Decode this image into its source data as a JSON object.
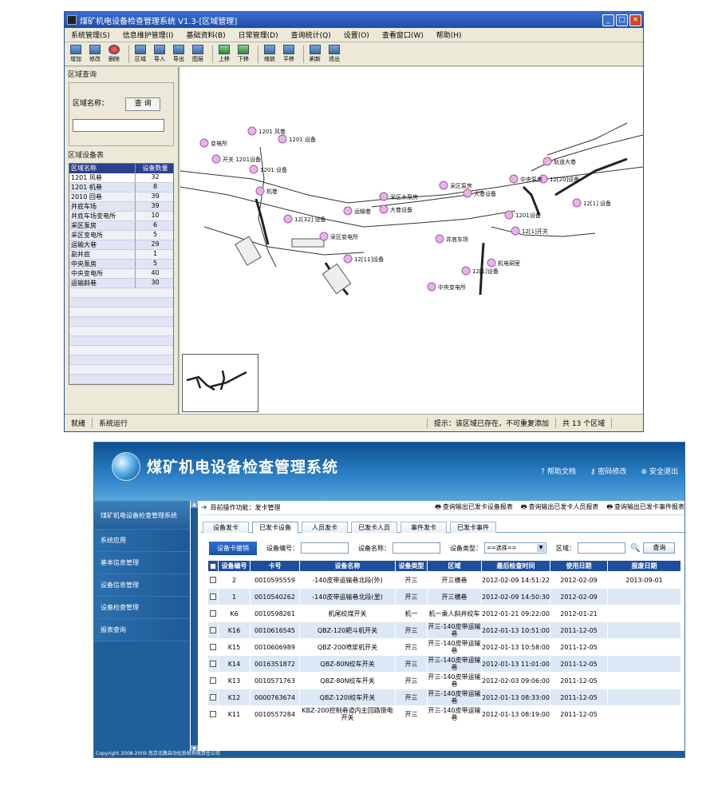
{
  "desktop": {
    "title": "煤矿机电设备检查管理系统 V1.3-[区域管理]",
    "menu": [
      "系统管理(S)",
      "信息维护管理(I)",
      "基础资料(B)",
      "日常管理(D)",
      "查询统计(Q)",
      "设置(O)",
      "查看窗口(W)",
      "帮助(H)"
    ],
    "toolbar": [
      "增加",
      "修改",
      "删除",
      "区域",
      "导入",
      "导出",
      "图层",
      "上移",
      "下移",
      "缩放",
      "平移",
      "刷新",
      "退出"
    ],
    "search_group_title": "区域查询",
    "search_label": "区域名称：",
    "search_button": "查 询",
    "list_group_title": "区域设备表",
    "list_headers": [
      "区域名称",
      "设备数量"
    ],
    "list_rows": [
      {
        "name": "1201 风巷",
        "count": "32"
      },
      {
        "name": "1201 机巷",
        "count": "8"
      },
      {
        "name": "2010 回巷",
        "count": "39"
      },
      {
        "name": "井底车场",
        "count": "39"
      },
      {
        "name": "井底车场变电所",
        "count": "10"
      },
      {
        "name": "采区泵房",
        "count": "6"
      },
      {
        "name": "采区变电所",
        "count": "5"
      },
      {
        "name": "运输大巷",
        "count": "29"
      },
      {
        "name": "副井底",
        "count": "1"
      },
      {
        "name": "中央泵房",
        "count": "5"
      },
      {
        "name": "中央变电所",
        "count": "40"
      },
      {
        "name": "运输斜巷",
        "count": "30"
      }
    ],
    "map_labels": [
      "1201 风巷",
      "1201 设备",
      "变电所",
      "开关 1201设备",
      "1201 设备",
      "机巷",
      "12[32] 设备",
      "运输巷",
      "大巷设备",
      "采区水泵房",
      "12[11]设备",
      "采区变电所",
      "大巷设备",
      "采区泵房",
      "中央泵房",
      "12[20]设备",
      "轨道大巷",
      "12[1] 设备",
      "机电硐室",
      "1201设备",
      "12[1]设备",
      "中央变电所",
      "12[1]开关",
      "井底车场"
    ],
    "status": [
      "就绪",
      "系统运行",
      "提示：该区域已存在，不可重复添加",
      "共 13 个区域"
    ]
  },
  "web": {
    "title": "煤矿机电设备检查管理系统",
    "top_links": [
      {
        "icon": "help-icon",
        "label": "帮助文档"
      },
      {
        "icon": "key-icon",
        "label": "密码修改"
      },
      {
        "icon": "exit-icon",
        "label": "安全退出"
      }
    ],
    "nav": [
      "煤矿机电设备检查管理系统",
      "系统应用",
      "基本信息管理",
      "设备信息管理",
      "设备检查管理",
      "报表查询"
    ],
    "crumb": "目前操作功能：发卡管理",
    "report_links": [
      "查询输出已发卡设备报表",
      "查询输出已发卡人员报表",
      "查询输出已发卡事件报表"
    ],
    "tabs": [
      "设备发卡",
      "已发卡设备",
      "人员发卡",
      "已发卡人员",
      "事件发卡",
      "已发卡事件"
    ],
    "active_tab": 1,
    "filters": {
      "revoke_button": "设备卡撤销",
      "code_label": "设备编号：",
      "name_label": "设备名称：",
      "type_label": "设备类型：",
      "type_value": "==选择==",
      "area_label": "区域：",
      "search_button": "查询"
    },
    "table": {
      "headers": [
        "设备编号",
        "卡号",
        "设备名称",
        "设备类型",
        "区域",
        "最后检查时间",
        "使用日期",
        "报废日期"
      ],
      "rows": [
        {
          "code": "2",
          "card": "0010595559",
          "name": "-140皮带运输巷北段(外)",
          "type": "开三",
          "area": "开三横巷",
          "last": "2012-02-09 14:51:22",
          "use": "2012-02-09",
          "scrap": "2013-09-01"
        },
        {
          "code": "1",
          "card": "0010540262",
          "name": "-140皮带运输巷北段(里)",
          "type": "开三",
          "area": "开三横巷",
          "last": "2012-02-09 14:50:30",
          "use": "2012-02-09",
          "scrap": ""
        },
        {
          "code": "K6",
          "card": "0010598261",
          "name": "机尾绞煤开关",
          "type": "机一",
          "area": "机一乘人斜井绞车",
          "last": "2012-01-21 09:22:00",
          "use": "2012-01-21",
          "scrap": ""
        },
        {
          "code": "K16",
          "card": "0010616545",
          "name": "QBZ-120耙斗机开关",
          "type": "开三",
          "area": "开三-140皮带运输巷",
          "last": "2012-01-13 10:51:00",
          "use": "2011-12-05",
          "scrap": ""
        },
        {
          "code": "K15",
          "card": "0010606989",
          "name": "QBZ-200喷浆机开关",
          "type": "开三",
          "area": "开三-140皮带运输巷",
          "last": "2012-01-13 10:58:00",
          "use": "2011-12-05",
          "scrap": ""
        },
        {
          "code": "K14",
          "card": "0016351872",
          "name": "QBZ-80N绞车开关",
          "type": "开三",
          "area": "开三-140皮带运输巷",
          "last": "2012-01-13 11:01:00",
          "use": "2011-12-05",
          "scrap": ""
        },
        {
          "code": "K13",
          "card": "0010571763",
          "name": "QBZ-80N绞车开关",
          "type": "开三",
          "area": "开三-140皮带运输巷",
          "last": "2012-02-03 09:06:00",
          "use": "2011-12-05",
          "scrap": ""
        },
        {
          "code": "K12",
          "card": "0000763674",
          "name": "QBZ-120I绞车开关",
          "type": "开三",
          "area": "开三-140皮带运输巷",
          "last": "2012-01-13 08:33:00",
          "use": "2011-12-05",
          "scrap": ""
        },
        {
          "code": "K11",
          "card": "0010557284",
          "name": "KBZ-200控制巷道内主回路馈电开关",
          "type": "开三",
          "area": "开三-140皮带运输巷",
          "last": "2012-01-13 08:19:00",
          "use": "2011-12-05",
          "scrap": ""
        }
      ]
    },
    "footer": "Copyright 2008-2009 南京北路自动化系统有限责任公司"
  }
}
